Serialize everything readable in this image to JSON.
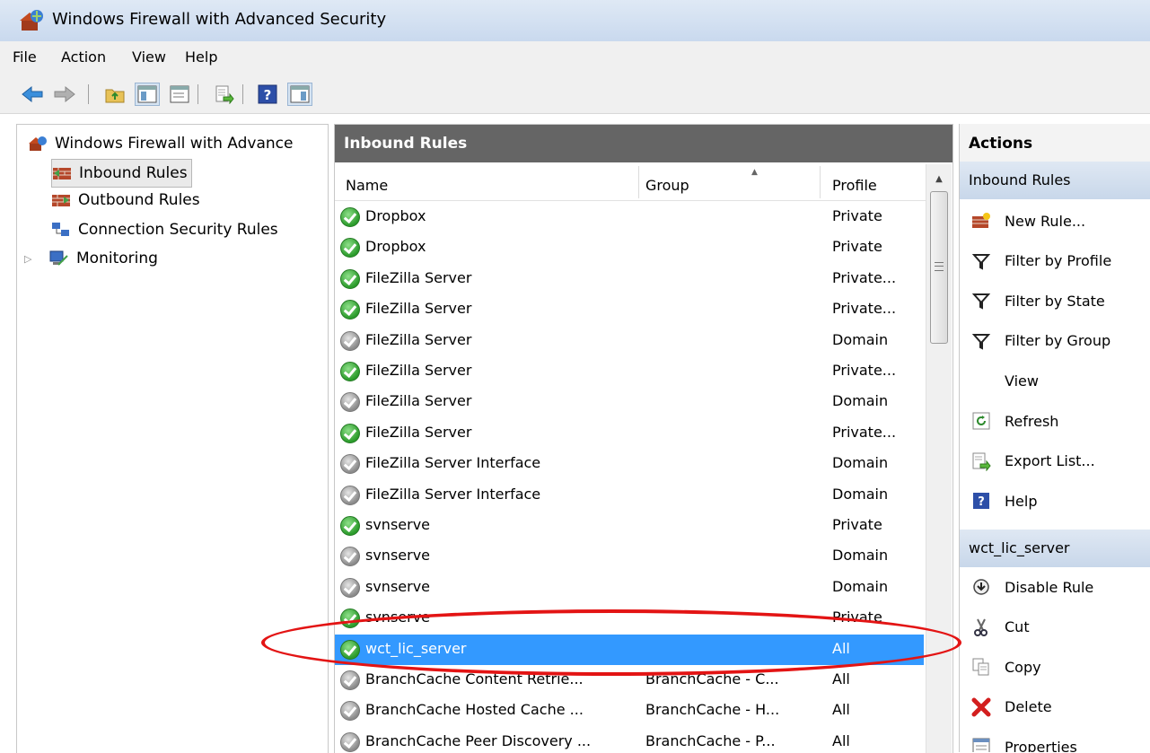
{
  "window": {
    "title": "Windows Firewall with Advanced Security"
  },
  "menu": [
    "File",
    "Action",
    "View",
    "Help"
  ],
  "toolbar_icons": [
    "back-arrow-icon",
    "forward-arrow-icon",
    "up-folder-icon",
    "show-hide-console-tree-icon",
    "export-list-icon",
    "help-icon",
    "show-hide-action-pane-icon"
  ],
  "tree": {
    "root": "Windows Firewall with Advance",
    "items": [
      {
        "label": "Inbound Rules",
        "icon": "inbound-rules-icon",
        "selected": true
      },
      {
        "label": "Outbound Rules",
        "icon": "outbound-rules-icon",
        "selected": false
      },
      {
        "label": "Connection Security Rules",
        "icon": "connection-security-icon",
        "selected": false
      },
      {
        "label": "Monitoring",
        "icon": "monitoring-icon",
        "selected": false
      }
    ]
  },
  "rules_pane": {
    "title": "Inbound Rules",
    "columns": {
      "name": "Name",
      "group": "Group",
      "profile": "Profile"
    },
    "rows": [
      {
        "name": "Dropbox",
        "group": "",
        "profile": "Private",
        "enabled": true,
        "selected": false
      },
      {
        "name": "Dropbox",
        "group": "",
        "profile": "Private",
        "enabled": true,
        "selected": false
      },
      {
        "name": "FileZilla Server",
        "group": "",
        "profile": "Private...",
        "enabled": true,
        "selected": false
      },
      {
        "name": "FileZilla Server",
        "group": "",
        "profile": "Private...",
        "enabled": true,
        "selected": false
      },
      {
        "name": "FileZilla Server",
        "group": "",
        "profile": "Domain",
        "enabled": false,
        "selected": false
      },
      {
        "name": "FileZilla Server",
        "group": "",
        "profile": "Private...",
        "enabled": true,
        "selected": false
      },
      {
        "name": "FileZilla Server",
        "group": "",
        "profile": "Domain",
        "enabled": false,
        "selected": false
      },
      {
        "name": "FileZilla Server",
        "group": "",
        "profile": "Private...",
        "enabled": true,
        "selected": false
      },
      {
        "name": "FileZilla Server Interface",
        "group": "",
        "profile": "Domain",
        "enabled": false,
        "selected": false
      },
      {
        "name": "FileZilla Server Interface",
        "group": "",
        "profile": "Domain",
        "enabled": false,
        "selected": false
      },
      {
        "name": "svnserve",
        "group": "",
        "profile": "Private",
        "enabled": true,
        "selected": false
      },
      {
        "name": "svnserve",
        "group": "",
        "profile": "Domain",
        "enabled": false,
        "selected": false
      },
      {
        "name": "svnserve",
        "group": "",
        "profile": "Domain",
        "enabled": false,
        "selected": false
      },
      {
        "name": "svnserve",
        "group": "",
        "profile": "Private",
        "enabled": true,
        "selected": false
      },
      {
        "name": "wct_lic_server",
        "group": "",
        "profile": "All",
        "enabled": true,
        "selected": true
      },
      {
        "name": "BranchCache Content Retrie...",
        "group": "BranchCache - C...",
        "profile": "All",
        "enabled": false,
        "selected": false
      },
      {
        "name": "BranchCache Hosted Cache ...",
        "group": "BranchCache - H...",
        "profile": "All",
        "enabled": false,
        "selected": false
      },
      {
        "name": "BranchCache Peer Discovery ...",
        "group": "BranchCache - P...",
        "profile": "All",
        "enabled": false,
        "selected": false
      }
    ]
  },
  "actions": {
    "title": "Actions",
    "section1": {
      "title": "Inbound Rules",
      "items": [
        {
          "label": "New Rule...",
          "icon": "new-rule-icon"
        },
        {
          "label": "Filter by Profile",
          "icon": "filter-icon"
        },
        {
          "label": "Filter by State",
          "icon": "filter-icon"
        },
        {
          "label": "Filter by Group",
          "icon": "filter-icon"
        },
        {
          "label": "View",
          "icon": ""
        },
        {
          "label": "Refresh",
          "icon": "refresh-icon"
        },
        {
          "label": "Export List...",
          "icon": "export-list-icon"
        },
        {
          "label": "Help",
          "icon": "help-icon"
        }
      ]
    },
    "section2": {
      "title": "wct_lic_server",
      "items": [
        {
          "label": "Disable Rule",
          "icon": "disable-rule-icon"
        },
        {
          "label": "Cut",
          "icon": "cut-icon"
        },
        {
          "label": "Copy",
          "icon": "copy-icon"
        },
        {
          "label": "Delete",
          "icon": "delete-icon"
        },
        {
          "label": "Properties",
          "icon": "properties-icon"
        }
      ]
    }
  },
  "colors": {
    "selection": "#3399ff",
    "annotation": "#e31414",
    "pane_header": "#656565",
    "enabled_status": "#2b9b2b",
    "disabled_status": "#8a8a8a"
  }
}
